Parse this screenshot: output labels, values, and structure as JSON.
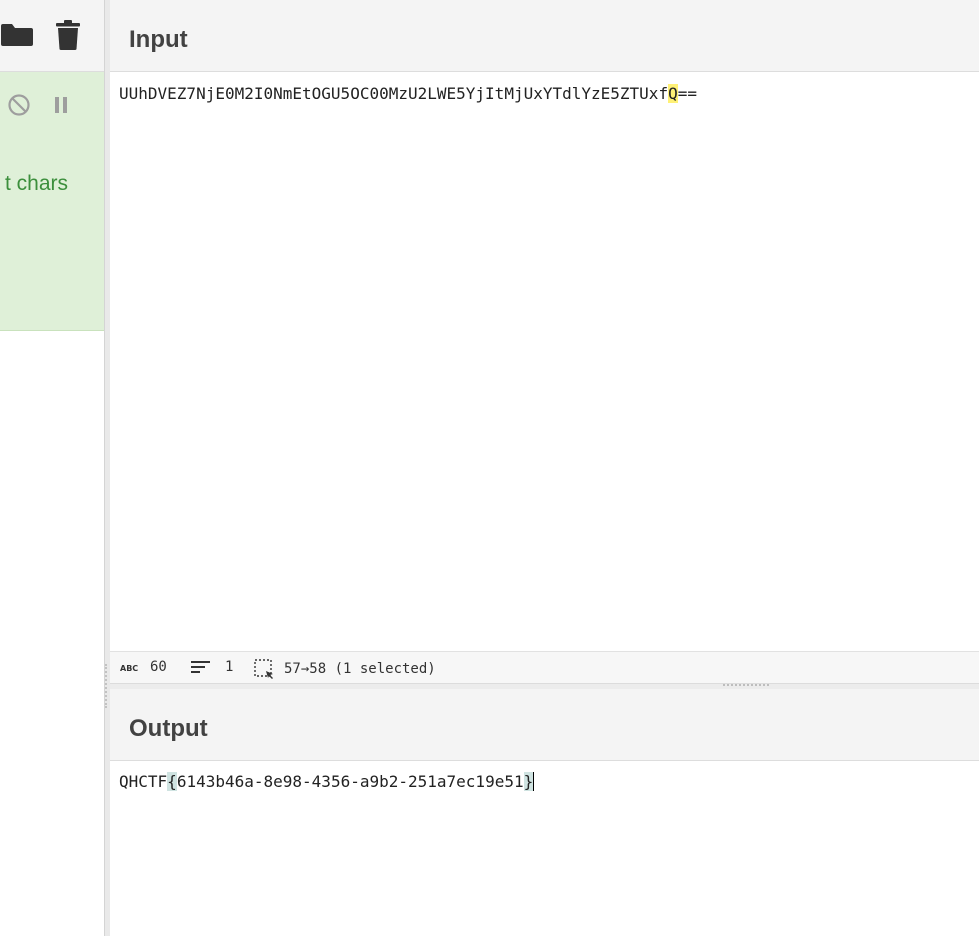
{
  "left_toolbar": {
    "icons": [
      "folder-icon",
      "trash-icon"
    ]
  },
  "operation": {
    "controls": [
      "disable-icon",
      "pause-icon"
    ],
    "text_fragment": "t chars",
    "colors": {
      "background": "#dff0d8",
      "text": "#3c8f3c"
    }
  },
  "input": {
    "title": "Input",
    "before_highlight": "UUhDVEZ7NjE0M2I0NmEtOGU5OC00MzU2LWE5YjItMjUxYTdlYzE5ZTUxf",
    "highlight": "Q",
    "after_highlight": "=="
  },
  "status": {
    "char_count_icon": "abc-icon",
    "char_count": "60",
    "lines_icon": "lines-icon",
    "line_count": "1",
    "selection_icon": "selection-icon",
    "selection": "57→58 (1 selected)"
  },
  "output": {
    "title": "Output",
    "prefix": "QHCTF",
    "brace_open": "{",
    "body": "6143b46a-8e98-4356-a9b2-251a7ec19e51",
    "brace_close": "}"
  },
  "colors": {
    "input_highlight": "#fff176",
    "output_highlight": "#cfe3e1"
  }
}
